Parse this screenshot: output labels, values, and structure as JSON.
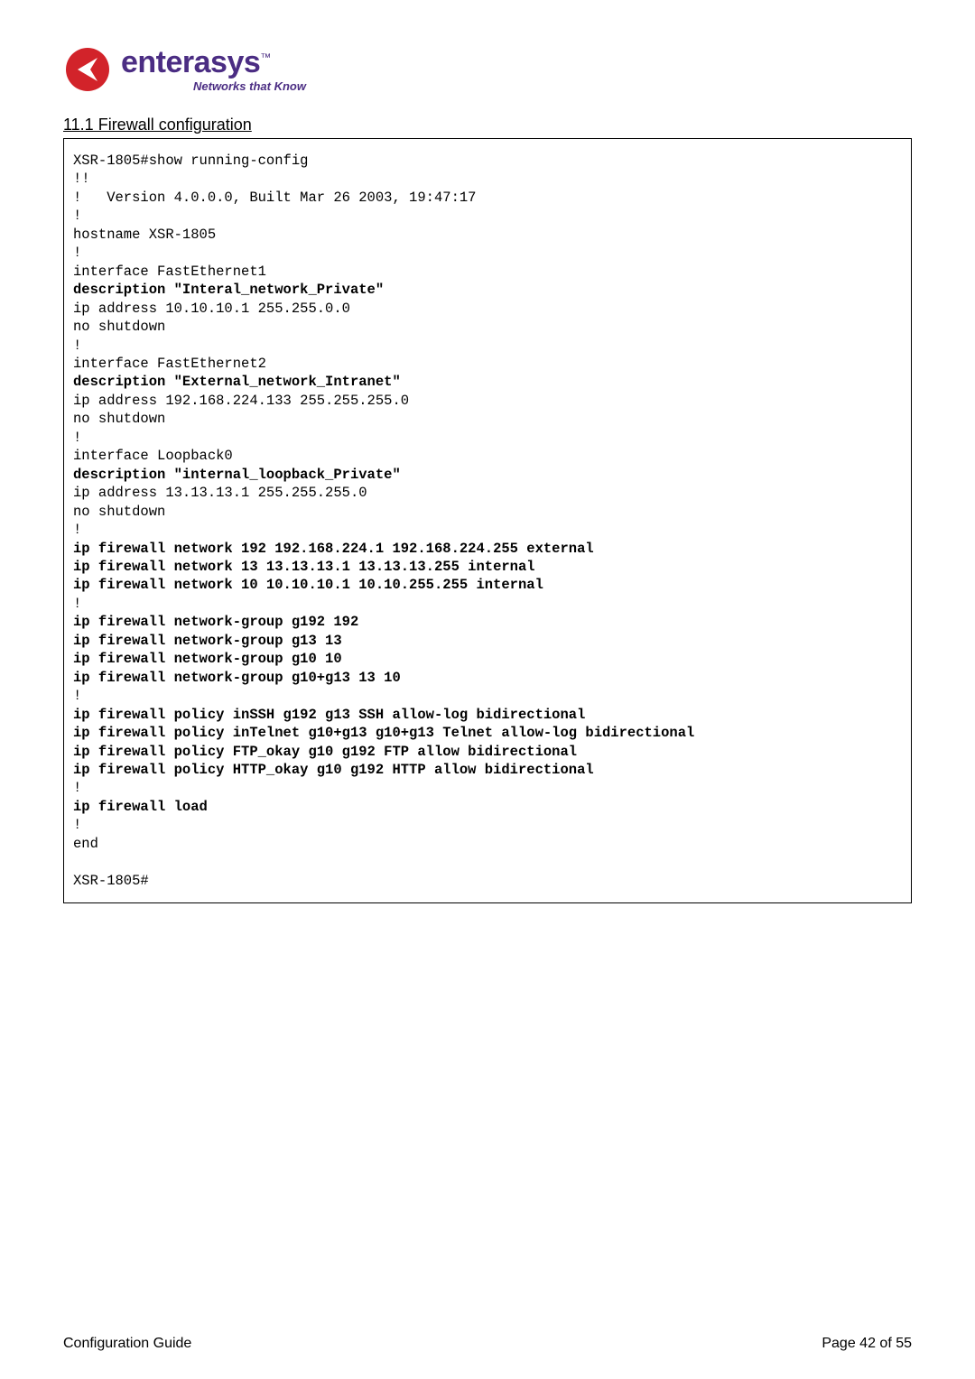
{
  "logo": {
    "brand": "enterasys",
    "tm": "™",
    "tagline": "Networks that Know"
  },
  "section": {
    "heading": "11.1 Firewall configuration"
  },
  "code": {
    "l01": "XSR-1805#show running-config",
    "l02": "!!",
    "l03": "!   Version 4.0.0.0, Built Mar 26 2003, 19:47:17",
    "l04": "!",
    "l05": "hostname XSR-1805",
    "l06": "!",
    "l07": "interface FastEthernet1",
    "l08": "description \"Interal_network_Private\"",
    "l09": "ip address 10.10.10.1 255.255.0.0",
    "l10": "no shutdown",
    "l11": "!",
    "l12": "interface FastEthernet2",
    "l13": "description \"External_network_Intranet\"",
    "l14": "ip address 192.168.224.133 255.255.255.0",
    "l15": "no shutdown",
    "l16": "!",
    "l17": "interface Loopback0",
    "l18": "description \"internal_loopback_Private\"",
    "l19": "ip address 13.13.13.1 255.255.255.0",
    "l20": "no shutdown",
    "l21": "!",
    "l22": "ip firewall network 192 192.168.224.1 192.168.224.255 external",
    "l23": "ip firewall network 13 13.13.13.1 13.13.13.255 internal",
    "l24": "ip firewall network 10 10.10.10.1 10.10.255.255 internal",
    "l25": "!",
    "l26": "ip firewall network-group g192 192",
    "l27": "ip firewall network-group g13 13",
    "l28": "ip firewall network-group g10 10",
    "l29": "ip firewall network-group g10+g13 13 10",
    "l30": "!",
    "l31": "ip firewall policy inSSH g192 g13 SSH allow-log bidirectional",
    "l32": "ip firewall policy inTelnet g10+g13 g10+g13 Telnet allow-log bidirectional",
    "l33": "ip firewall policy FTP_okay g10 g192 FTP allow bidirectional",
    "l34": "ip firewall policy HTTP_okay g10 g192 HTTP allow bidirectional",
    "l35": "!",
    "l36": "ip firewall load",
    "l37": "!",
    "l38": "end",
    "l39": "",
    "l40": "XSR-1805#"
  },
  "footer": {
    "left": "Configuration Guide",
    "right": "Page 42 of 55"
  }
}
